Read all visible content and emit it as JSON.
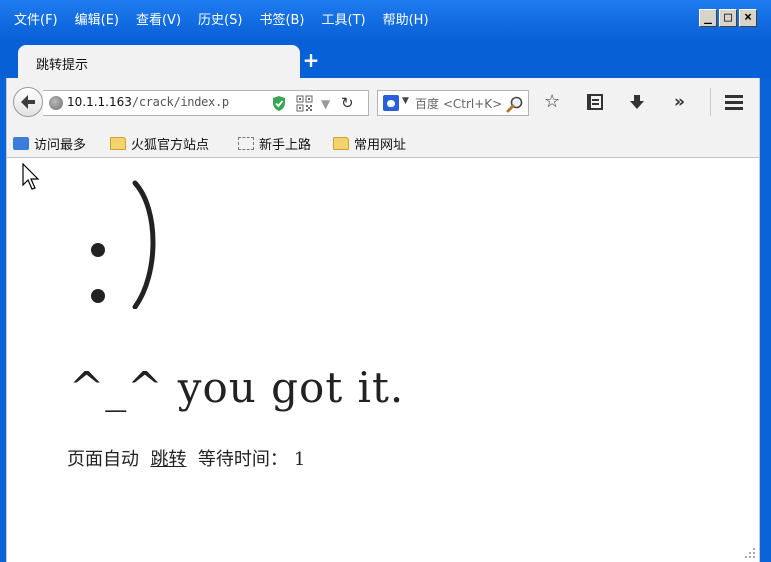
{
  "menu": [
    "文件(F)",
    "编辑(E)",
    "查看(V)",
    "历史(S)",
    "书签(B)",
    "工具(T)",
    "帮助(H)"
  ],
  "window_buttons": {
    "minimize": "_",
    "maximize": "□",
    "close": "×"
  },
  "tab": {
    "title": "跳转提示",
    "new_tab": "+"
  },
  "url": {
    "host": "10.1.1.163",
    "path": "/crack/index.p"
  },
  "search": {
    "placeholder": "百度 <Ctrl+K>"
  },
  "bookmarks": [
    "访问最多",
    "火狐官方站点",
    "新手上路",
    "常用网址"
  ],
  "page": {
    "smiley": ":)",
    "message": "^_^ you got it.",
    "redirect_prefix": "页面自动",
    "redirect_link": "跳转",
    "wait_label": "等待时间：",
    "wait_seconds": "1"
  },
  "icons": {
    "back": "back-arrow-icon",
    "globe": "globe-icon",
    "shield": "shield-check-icon",
    "qr": "qr-code-icon",
    "reload": "reload-icon",
    "search_engine": "baidu-paw-icon",
    "magnify": "magnifier-icon",
    "star": "star-icon",
    "reading_list": "reading-list-icon",
    "download": "download-arrow-icon",
    "overflow": "chevron-double-right-icon",
    "hamburger": "menu-icon"
  },
  "colors": {
    "titlebar": "#0860d6",
    "toolbar": "#f2f2f2",
    "shield": "#3aa655"
  }
}
